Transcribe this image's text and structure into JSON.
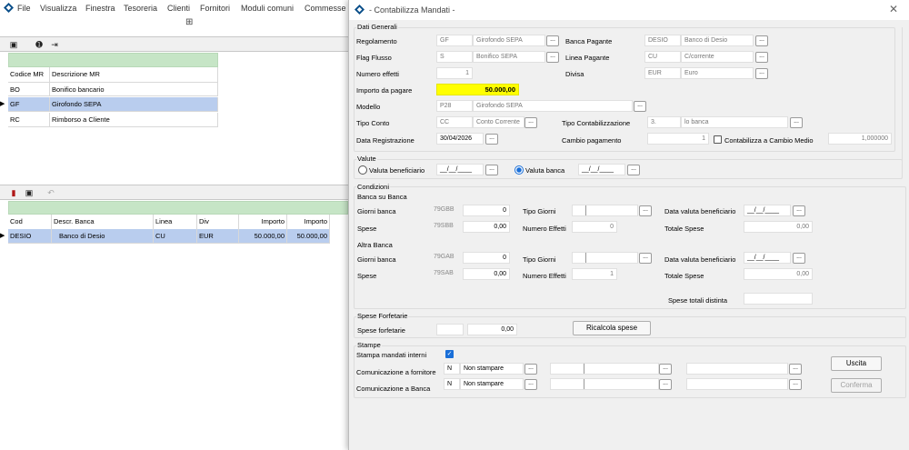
{
  "menu": [
    "File",
    "Visualizza",
    "Finestra",
    "Tesoreria",
    "Clienti",
    "Fornitori",
    "Moduli comuni",
    "Commesse"
  ],
  "upper_grid": {
    "headers": [
      "Codice MR",
      "Descrizione MR"
    ],
    "rows": [
      [
        "BO",
        "Bonifico bancario"
      ],
      [
        "GF",
        "Girofondo SEPA"
      ],
      [
        "RC",
        "Rimborso a Cliente"
      ]
    ]
  },
  "lower_grid": {
    "headers": [
      "Cod",
      "Descr. Banca",
      "Linea",
      "Div",
      "Importo",
      "Importo"
    ],
    "rows": [
      [
        "DESIO",
        "Banco di Desio",
        "CU",
        "EUR",
        "50.000,00",
        "50.000,00"
      ]
    ]
  },
  "dialog": {
    "title": "- Contabilizza Mandati -",
    "dati_generali": {
      "group": "Dati Generali",
      "regolamento_lbl": "Regolamento",
      "regolamento_code": "GF",
      "regolamento_desc": "Girofondo SEPA",
      "banca_pagante_lbl": "Banca Pagante",
      "banca_pagante_code": "DESIO",
      "banca_pagante_desc": "Banco di Desio",
      "flag_flusso_lbl": "Flag Flusso",
      "flag_flusso_code": "S",
      "flag_flusso_desc": "Bonifico SEPA",
      "linea_pagante_lbl": "Linea Pagante",
      "linea_pagante_code": "CU",
      "linea_pagante_desc": "C/corrente",
      "numero_effetti_lbl": "Numero effetti",
      "numero_effetti": "1",
      "divisa_lbl": "Divisa",
      "divisa_code": "EUR",
      "divisa_desc": "Euro",
      "importo_lbl": "Importo da pagare",
      "importo": "50.000,00",
      "modello_lbl": "Modello",
      "modello_code": "P28",
      "modello_desc": "Girofondo SEPA",
      "tipo_conto_lbl": "Tipo Conto",
      "tipo_conto_code": "CC",
      "tipo_conto_desc": "Conto Corrente",
      "tipo_contab_lbl": "Tipo Contabilizzazione",
      "tipo_contab_code": "3.",
      "tipo_contab_desc": "lo banca",
      "data_reg_lbl": "Data Registrazione",
      "data_reg": "30/04/2026",
      "cambio_lbl": "Cambio pagamento",
      "cambio": "1",
      "cambio_medio_lbl": "Contabilizza a Cambio Medio",
      "cambio_medio": "1,000000"
    },
    "valute": {
      "group": "Valute",
      "benef_lbl": "Valuta beneficiario",
      "benef_val": "__/__/____",
      "banca_lbl": "Valuta banca",
      "banca_val": "__/__/____"
    },
    "condizioni": {
      "group": "Condizioni",
      "banca_su_banca": "Banca su Banca",
      "giorni_banca_lbl": "Giorni banca",
      "giorni_code_a": "79GBB",
      "giorni_val_a": "0",
      "tipo_giorni_lbl": "Tipo Giorni",
      "data_valuta_lbl": "Data valuta beneficiario",
      "data_valuta_a": "__/__/____",
      "spese_lbl": "Spese",
      "spese_code_a": "79SBB",
      "spese_val_a": "0,00",
      "numero_effetti_lbl": "Numero Effetti",
      "num_eff_a": "0",
      "totale_spese_lbl": "Totale Spese",
      "tot_spese_a": "0,00",
      "altra_banca": "Altra Banca",
      "giorni_code_b": "79GAB",
      "giorni_val_b": "0",
      "data_valuta_b": "__/__/____",
      "spese_code_b": "79SAB",
      "spese_val_b": "0,00",
      "num_eff_b": "1",
      "tot_spese_b": "0,00",
      "spese_totali_lbl": "Spese totali distinta"
    },
    "forfetarie": {
      "group": "Spese Forfetarie",
      "lbl": "Spese forfetarie",
      "val": "0,00",
      "ricalcola": "Ricalcola spese"
    },
    "stampe": {
      "group": "Stampe",
      "interni_lbl": "Stampa mandati interni",
      "fornitore_lbl": "Comunicazione a fornitore",
      "fornitore_code": "N",
      "fornitore_desc": "Non stampare",
      "banca_lbl": "Comunicazione a Banca",
      "banca_code": "N",
      "banca_desc": "Non stampare",
      "uscita": "Uscita",
      "conferma": "Conferma"
    },
    "ellipsis": "..."
  },
  "colors": {
    "highlight": "#ffff00",
    "selection": "#b9cdee",
    "grid_header": "#c6e5c6",
    "accent": "#1a6fd8"
  }
}
